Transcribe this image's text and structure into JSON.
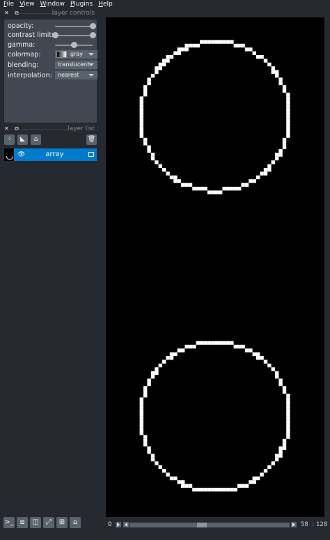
{
  "menu": [
    "File",
    "View",
    "Window",
    "Plugins",
    "Help"
  ],
  "layer_controls": {
    "title": "layer controls",
    "opacity_label": "opacity:",
    "opacity_value": 1.0,
    "contrast_label": "contrast limits",
    "contrast_low": 0.0,
    "contrast_high": 1.0,
    "gamma_label": "gamma:",
    "gamma_value": 0.5,
    "colormap_label": "colormap:",
    "colormap_value": "gray",
    "blending_label": "blending:",
    "blending_value": "translucent",
    "interpolation_label": "interpolation:",
    "interpolation_value": "nearest"
  },
  "layer_list": {
    "title": "layer list",
    "layers": [
      {
        "name": "array",
        "visible": true,
        "selected": true
      }
    ]
  },
  "dims": {
    "start": "0",
    "current": "58",
    "separator": ":",
    "max": "128",
    "position_fraction": 0.45
  },
  "colors": {
    "background": "#262930",
    "panel": "#414851",
    "selected": "#007acc",
    "canvas": "#000000",
    "ring": "#ffffff"
  },
  "icons": {
    "console": "console-icon",
    "ndisplay": "cube-icon",
    "roll": "roll-icon",
    "transpose": "transpose-icon",
    "grid": "grid-icon",
    "home": "home-icon"
  }
}
